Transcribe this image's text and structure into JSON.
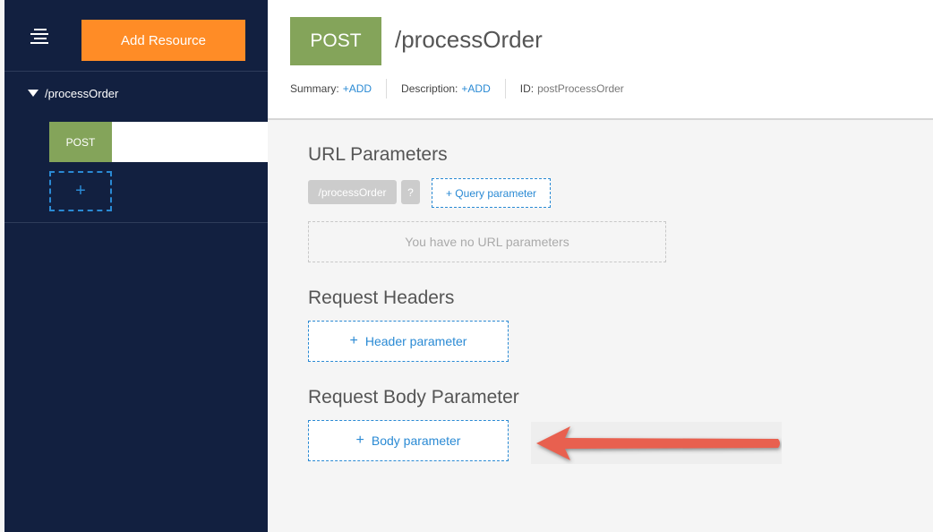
{
  "sidebar": {
    "add_resource_label": "Add Resource",
    "resource_path": "/processOrder",
    "method_label": "POST",
    "add_method_label": "+"
  },
  "header": {
    "method": "POST",
    "path": "/processOrder",
    "summary_label": "Summary:",
    "summary_action": "+ADD",
    "description_label": "Description:",
    "description_action": "+ADD",
    "id_label": "ID:",
    "id_value": "postProcessOrder"
  },
  "url_parameters": {
    "title": "URL Parameters",
    "path_pill": "/processOrder",
    "query_pill": "?",
    "query_button": "+ Query parameter",
    "empty_text": "You have no URL parameters"
  },
  "request_headers": {
    "title": "Request Headers",
    "button_plus": "+",
    "button_label": "Header parameter"
  },
  "request_body": {
    "title": "Request Body Parameter",
    "button_plus": "+",
    "button_label": "Body parameter"
  },
  "colors": {
    "sidebar_bg": "#122040",
    "accent_orange": "#ff8c26",
    "method_green": "#84a45a",
    "link_blue": "#2a8ad4",
    "arrow_red": "#e8604f"
  },
  "icons": [
    "menu-icon",
    "caret-down-icon",
    "plus-icon",
    "arrow-left-icon"
  ]
}
